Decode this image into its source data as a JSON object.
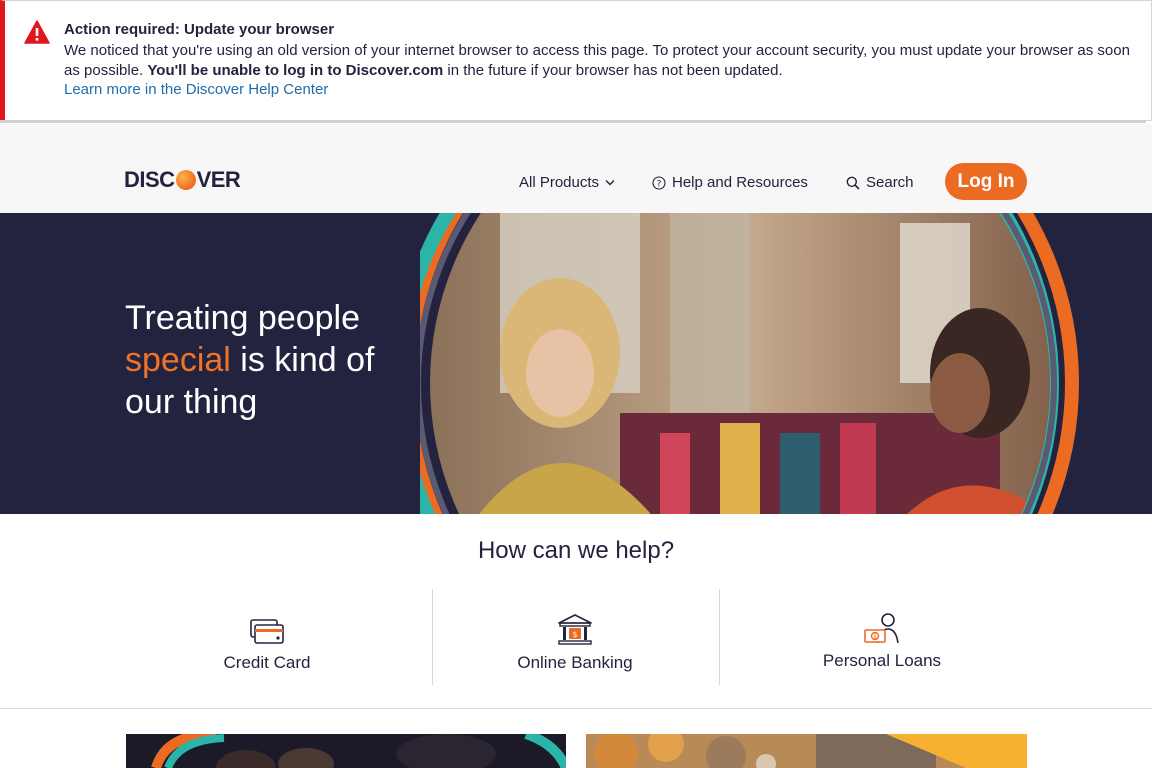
{
  "alert": {
    "title": "Action required: Update your browser",
    "text_part1": "We noticed that you're using an old version of your internet browser to access this page. To protect your account security, you must update your browser as soon as possible.",
    "text_bold": "You'll be unable to log in to Discover.com",
    "text_part2": "in the future if your browser has not been updated.",
    "link": "Learn more in the Discover Help Center",
    "icon": "warning-triangle-icon",
    "color": "#e0171c"
  },
  "header": {
    "logo_left": "DISC",
    "logo_right": "VER",
    "nav": {
      "products": "All Products",
      "help": "Help and Resources",
      "search": "Search"
    },
    "login": "Log In",
    "accent_color": "#ec6b23"
  },
  "hero": {
    "line1": "Treating people",
    "accent_word": "special",
    "line2_rest": " is kind of",
    "line3": "our thing",
    "background_color": "#23233f"
  },
  "help": {
    "title": "How can we help?",
    "items": [
      {
        "label": "Credit Card",
        "icon": "credit-card-icon"
      },
      {
        "label": "Online Banking",
        "icon": "bank-icon"
      },
      {
        "label": "Personal Loans",
        "icon": "personal-loan-icon"
      }
    ]
  }
}
